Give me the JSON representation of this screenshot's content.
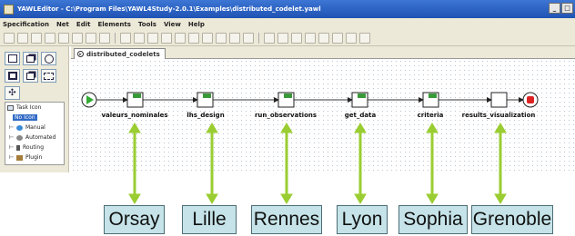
{
  "window": {
    "title": "YAWLEditor - C:\\Program Files\\YAWL4Study-2.0.1\\Examples\\distributed_codelet.yawl"
  },
  "menu": [
    "Specification",
    "Net",
    "Edit",
    "Elements",
    "Tools",
    "View",
    "Help"
  ],
  "palette": {
    "task_icon_title": "Task Icon",
    "items": [
      "No Icon",
      "Manual",
      "Automated",
      "Routing",
      "Plugin"
    ]
  },
  "tab": {
    "label": "distributed_codelets"
  },
  "net": {
    "tasks": [
      "valeurs_nominales",
      "lhs_design",
      "run_observations",
      "get_data",
      "criteria",
      "results_visualization"
    ]
  },
  "cities": [
    "Orsay",
    "Lille",
    "Rennes",
    "Lyon",
    "Sophia",
    "Grenoble"
  ],
  "colors": {
    "arrow_green": "#9acd32",
    "city_box": "#c5e3e8",
    "start_condition": "#33aa33",
    "end_condition": "#dd2222"
  }
}
